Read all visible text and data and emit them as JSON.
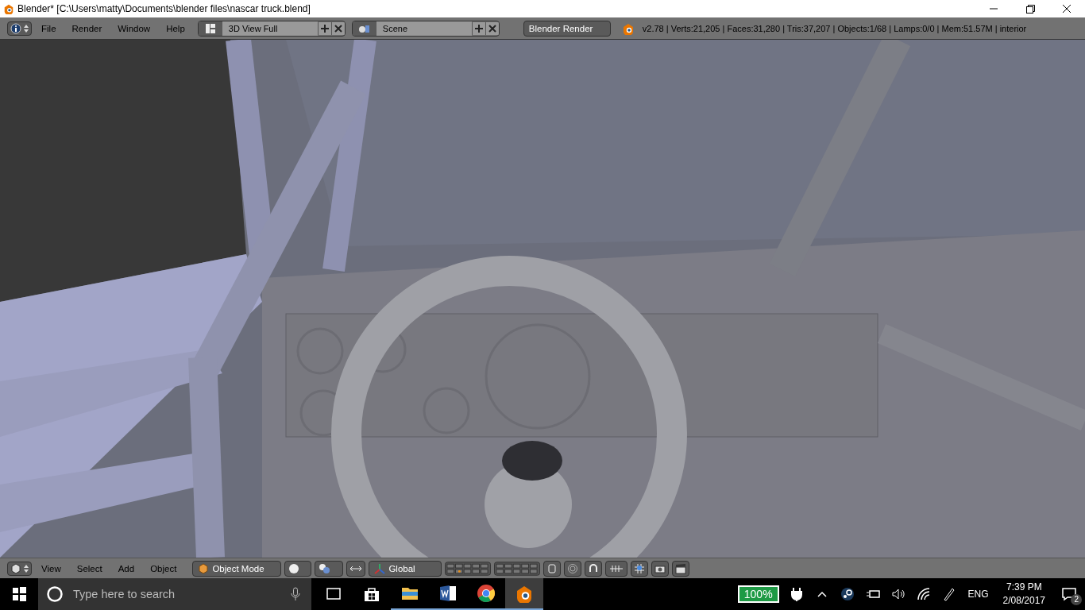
{
  "window": {
    "title": "Blender* [C:\\Users\\matty\\Documents\\blender files\\nascar truck.blend]"
  },
  "info_header": {
    "menus": [
      "File",
      "Render",
      "Window",
      "Help"
    ],
    "screen_layout": "3D View Full",
    "scene": "Scene",
    "render_engine": "Blender Render",
    "stats": "v2.78 | Verts:21,205 | Faces:31,280 | Tris:37,207 | Objects:1/68 | Lamps:0/0 | Mem:51.57M | interior"
  },
  "view3d_header": {
    "menus": [
      "View",
      "Select",
      "Add",
      "Object"
    ],
    "mode": "Object Mode",
    "orientation": "Global"
  },
  "taskbar": {
    "search": {
      "placeholder": "Type here to search"
    },
    "apps": [
      {
        "kind": "store",
        "running": false,
        "selected": false
      },
      {
        "kind": "folder",
        "running": true,
        "selected": false
      },
      {
        "kind": "word",
        "running": true,
        "selected": false
      },
      {
        "kind": "chrome",
        "running": true,
        "selected": false
      },
      {
        "kind": "blender",
        "running": true,
        "selected": true
      }
    ],
    "battery": "100%",
    "language": "ENG",
    "time": "7:39 PM",
    "date": "2/08/2017",
    "notifications": "2"
  }
}
